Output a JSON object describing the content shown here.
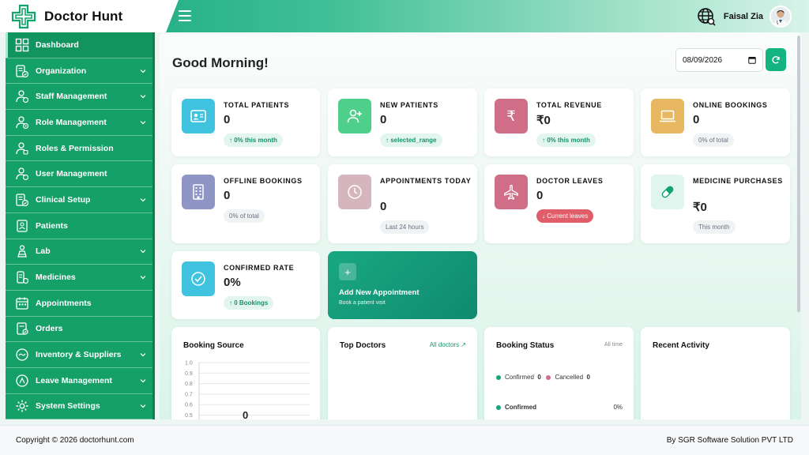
{
  "app": {
    "title": "Doctor Hunt"
  },
  "header": {
    "user_name": "Faisal Zia"
  },
  "sidebar": {
    "items": [
      {
        "label": "Dashboard",
        "icon": "grid-icon",
        "has_children": false
      },
      {
        "label": "Organization",
        "icon": "building-icon",
        "has_children": true
      },
      {
        "label": "Staff Management",
        "icon": "staff-icon",
        "has_children": true
      },
      {
        "label": "Role Management",
        "icon": "role-icon",
        "has_children": true
      },
      {
        "label": "Roles & Permission",
        "icon": "permission-icon",
        "has_children": false
      },
      {
        "label": "User Management",
        "icon": "user-icon",
        "has_children": false
      },
      {
        "label": "Clinical Setup",
        "icon": "clinical-icon",
        "has_children": true
      },
      {
        "label": "Patients",
        "icon": "patients-icon",
        "has_children": false
      },
      {
        "label": "Lab",
        "icon": "lab-icon",
        "has_children": true
      },
      {
        "label": "Medicines",
        "icon": "medicines-icon",
        "has_children": true
      },
      {
        "label": "Appointments",
        "icon": "calendar-icon",
        "has_children": false
      },
      {
        "label": "Orders",
        "icon": "orders-icon",
        "has_children": false
      },
      {
        "label": "Inventory & Suppliers",
        "icon": "inventory-icon",
        "has_children": true
      },
      {
        "label": "Leave Management",
        "icon": "leave-icon",
        "has_children": true
      },
      {
        "label": "System Settings",
        "icon": "settings-icon",
        "has_children": true
      }
    ]
  },
  "main": {
    "greeting": "Good Morning!",
    "date_value": "08/09/2026",
    "stats": {
      "total_patients": {
        "title": "TOTAL PATIENTS",
        "value": "0",
        "badge": "0% this month"
      },
      "new_patients": {
        "title": "NEW PATIENTS",
        "value": "0",
        "badge": "selected_range"
      },
      "total_revenue": {
        "title": "TOTAL REVENUE",
        "value": "₹0",
        "badge": "0% this month"
      },
      "online_bookings": {
        "title": "ONLINE BOOKINGS",
        "value": "0",
        "badge": "0% of total"
      },
      "offline_bookings": {
        "title": "OFFLINE BOOKINGS",
        "value": "0",
        "badge": "0% of total"
      },
      "appointments_today": {
        "title": "APPOINTMENTS TODAY",
        "value": "0",
        "badge": "Last 24 hours"
      },
      "doctor_leaves": {
        "title": "DOCTOR LEAVES",
        "value": "0",
        "badge": "Current leaves"
      },
      "medicine_purchases": {
        "title": "MEDICINE PURCHASES",
        "value": "₹0",
        "badge": "This month"
      },
      "confirmed_rate": {
        "title": "CONFIRMED RATE",
        "value": "0%",
        "badge": "0 Bookings"
      }
    },
    "add_appointment": {
      "title": "Add New Appointment",
      "subtitle": "Book a patient visit",
      "plus": "+"
    },
    "booking_source": {
      "title": "Booking Source",
      "center_value": "0"
    },
    "top_doctors": {
      "title": "Top Doctors",
      "link": "All doctors ↗"
    },
    "booking_status": {
      "title": "Booking Status",
      "range": "All time",
      "confirmed_label": "Confirmed",
      "confirmed_value": "0",
      "cancelled_label": "Cancelled",
      "cancelled_value": "0",
      "row_label": "Confirmed",
      "row_value": "0%"
    },
    "recent_activity": {
      "title": "Recent Activity"
    },
    "colors": {
      "primary": "#15a067",
      "accent": "#14b482",
      "patients_icon_bg": "#3fc3df",
      "new_patients_icon_bg": "#4fd08a",
      "revenue_icon_bg": "#d06e87",
      "online_icon_bg": "#e8b761",
      "offline_icon_bg": "#8f95c4",
      "appointments_icon_bg": "#d6b6bd",
      "leaves_icon_bg": "#d06e87",
      "medicine_icon_bg": "#dff5ee",
      "confirmed_icon_bg": "#3fc3df",
      "confirmed_dot": "#14a57d",
      "cancelled_dot": "#d06e87"
    }
  },
  "chart_data": {
    "type": "bar",
    "title": "Booking Source",
    "categories": [],
    "values": [],
    "ylim": [
      0.5,
      1.0
    ],
    "yticks": [
      "1.0",
      "0.9",
      "0.8",
      "0.7",
      "0.6",
      "0.5"
    ],
    "grid": true
  },
  "footer": {
    "copyright": "Copyright © 2026 doctorhunt.com",
    "company": "By SGR Software Solution PVT LTD"
  }
}
